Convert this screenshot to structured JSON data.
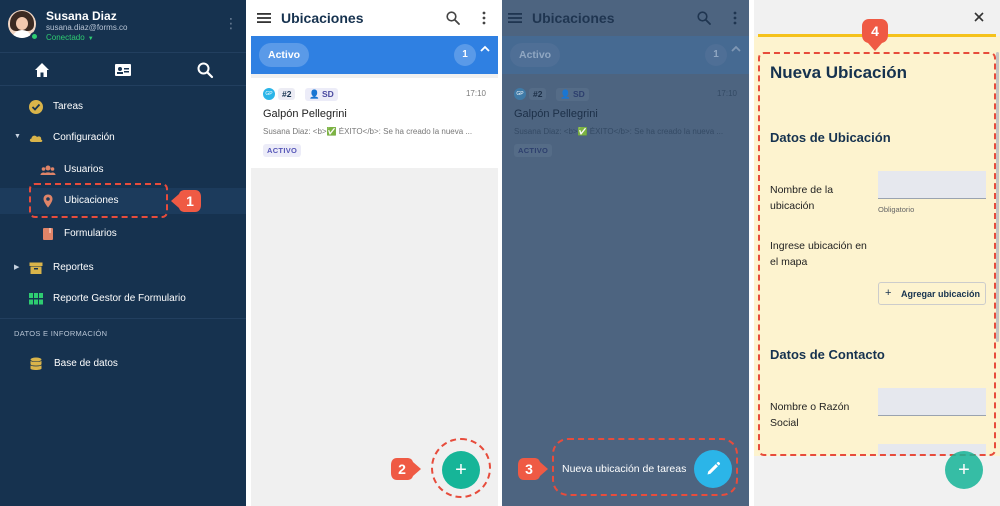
{
  "sidebar": {
    "user": {
      "name": "Susana Diaz",
      "email": "susana.diaz@forms.co",
      "status": "Conectado"
    },
    "items": [
      {
        "label": "Tareas",
        "icon": "check-circle-icon"
      },
      {
        "label": "Configuración",
        "icon": "cloud-icon"
      },
      {
        "label": "Usuarios",
        "icon": "users-icon"
      },
      {
        "label": "Ubicaciones",
        "icon": "map-pin-icon"
      },
      {
        "label": "Formularios",
        "icon": "book-icon"
      },
      {
        "label": "Reportes",
        "icon": "archive-icon"
      },
      {
        "label": "Reporte Gestor de Formulario",
        "icon": "grid-icon"
      },
      {
        "label": "Base de datos",
        "icon": "database-icon"
      }
    ],
    "section_label": "DATOS E INFORMACIÓN"
  },
  "list": {
    "title": "Ubicaciones",
    "group_label": "Activo",
    "group_count": "1",
    "card": {
      "avatar": "GP",
      "number": "#2",
      "assignee": "SD",
      "time": "17:10",
      "name": "Galpón Pellegrini",
      "description": "Susana Diaz: <b>✅ ÉXITO</b>: Se ha creado la nueva ...",
      "status": "ACTIVO"
    }
  },
  "fab_menu": {
    "label": "Nueva ubicación de tareas"
  },
  "form": {
    "title": "Nueva Ubicación",
    "section1": "Datos de Ubicación",
    "field_name_label": "Nombre de la ubicación",
    "field_name_hint": "Obligatorio",
    "field_map_label": "Ingrese ubicación en el mapa",
    "add_location_label": "Agregar ubicación",
    "section2": "Datos de Contacto",
    "field_company_label": "Nombre o Razón Social"
  },
  "steps": {
    "s1": "1",
    "s2": "2",
    "s3": "3",
    "s4": "4"
  },
  "colors": {
    "sidebar_bg": "#16324f",
    "accent_blue": "#2f80e2",
    "fab_green": "#16b598",
    "fab_cyan": "#2bb5e8",
    "callout_red": "#ef5a44",
    "form_bg": "#fdf3cf"
  }
}
